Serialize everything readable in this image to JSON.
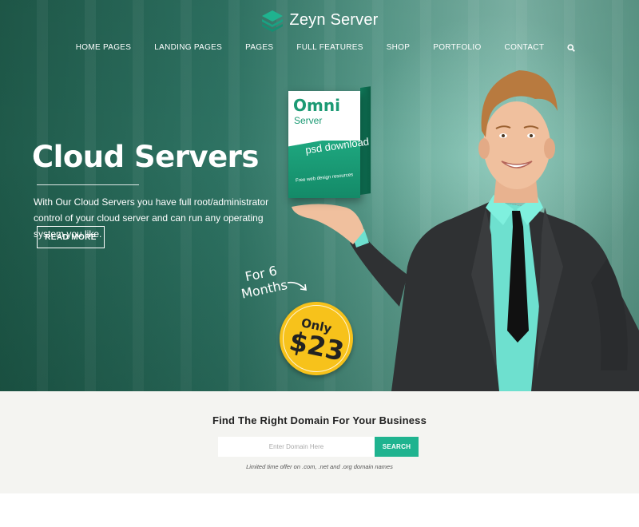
{
  "brand": {
    "name": "Zeyn Server",
    "accent": "#1fb38f"
  },
  "nav": {
    "items": [
      {
        "label": "HOME PAGES"
      },
      {
        "label": "LANDING PAGES"
      },
      {
        "label": "PAGES"
      },
      {
        "label": "FULL FEATURES"
      },
      {
        "label": "SHOP"
      },
      {
        "label": "PORTFOLIO"
      },
      {
        "label": "CONTACT"
      }
    ],
    "search_icon": "search-icon"
  },
  "hero": {
    "title": "Cloud Servers",
    "description": "With Our Cloud Servers you have full root/administrator control of your cloud server and can run any operating system you like.",
    "cta_label": "READ MORE"
  },
  "product": {
    "title": "Omni",
    "subtitle": "Server",
    "tagline": "psd download",
    "footer": "Free web design resources"
  },
  "offer": {
    "duration": "For 6 Months",
    "prefix": "Only",
    "price": "$23",
    "badge_color": "#f7c21b"
  },
  "domain_search": {
    "title": "Find The Right Domain For Your Business",
    "placeholder": "Enter Domain Here",
    "button_label": "SEARCH",
    "note": "Limited time offer on .com, .net and .org domain names"
  }
}
